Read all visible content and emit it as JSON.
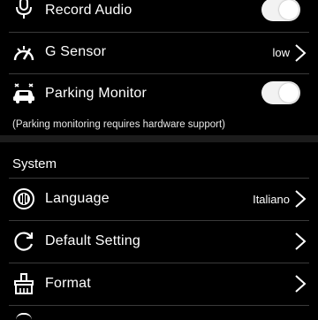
{
  "settings": {
    "record_audio": {
      "label": "Record Audio",
      "icon": "microphone-icon",
      "enabled": true
    },
    "g_sensor": {
      "label": "G Sensor",
      "value": "low",
      "icon": "gauge-icon"
    },
    "parking_monitor": {
      "label": "Parking Monitor",
      "icon": "parked-car-icon",
      "enabled": false
    },
    "parking_note": "(Parking monitoring requires hardware support)"
  },
  "system": {
    "title": "System",
    "language": {
      "label": "Language",
      "value": "Italiano",
      "icon": "language-icon"
    },
    "default_setting": {
      "label": "Default Setting",
      "icon": "refresh-icon"
    },
    "format": {
      "label": "Format",
      "icon": "format-brush-icon"
    }
  },
  "colors": {
    "background": "#000000",
    "divider": "#3a3a3a",
    "section_band": "#1c1c1c",
    "toggle": "#f2f2f2"
  }
}
